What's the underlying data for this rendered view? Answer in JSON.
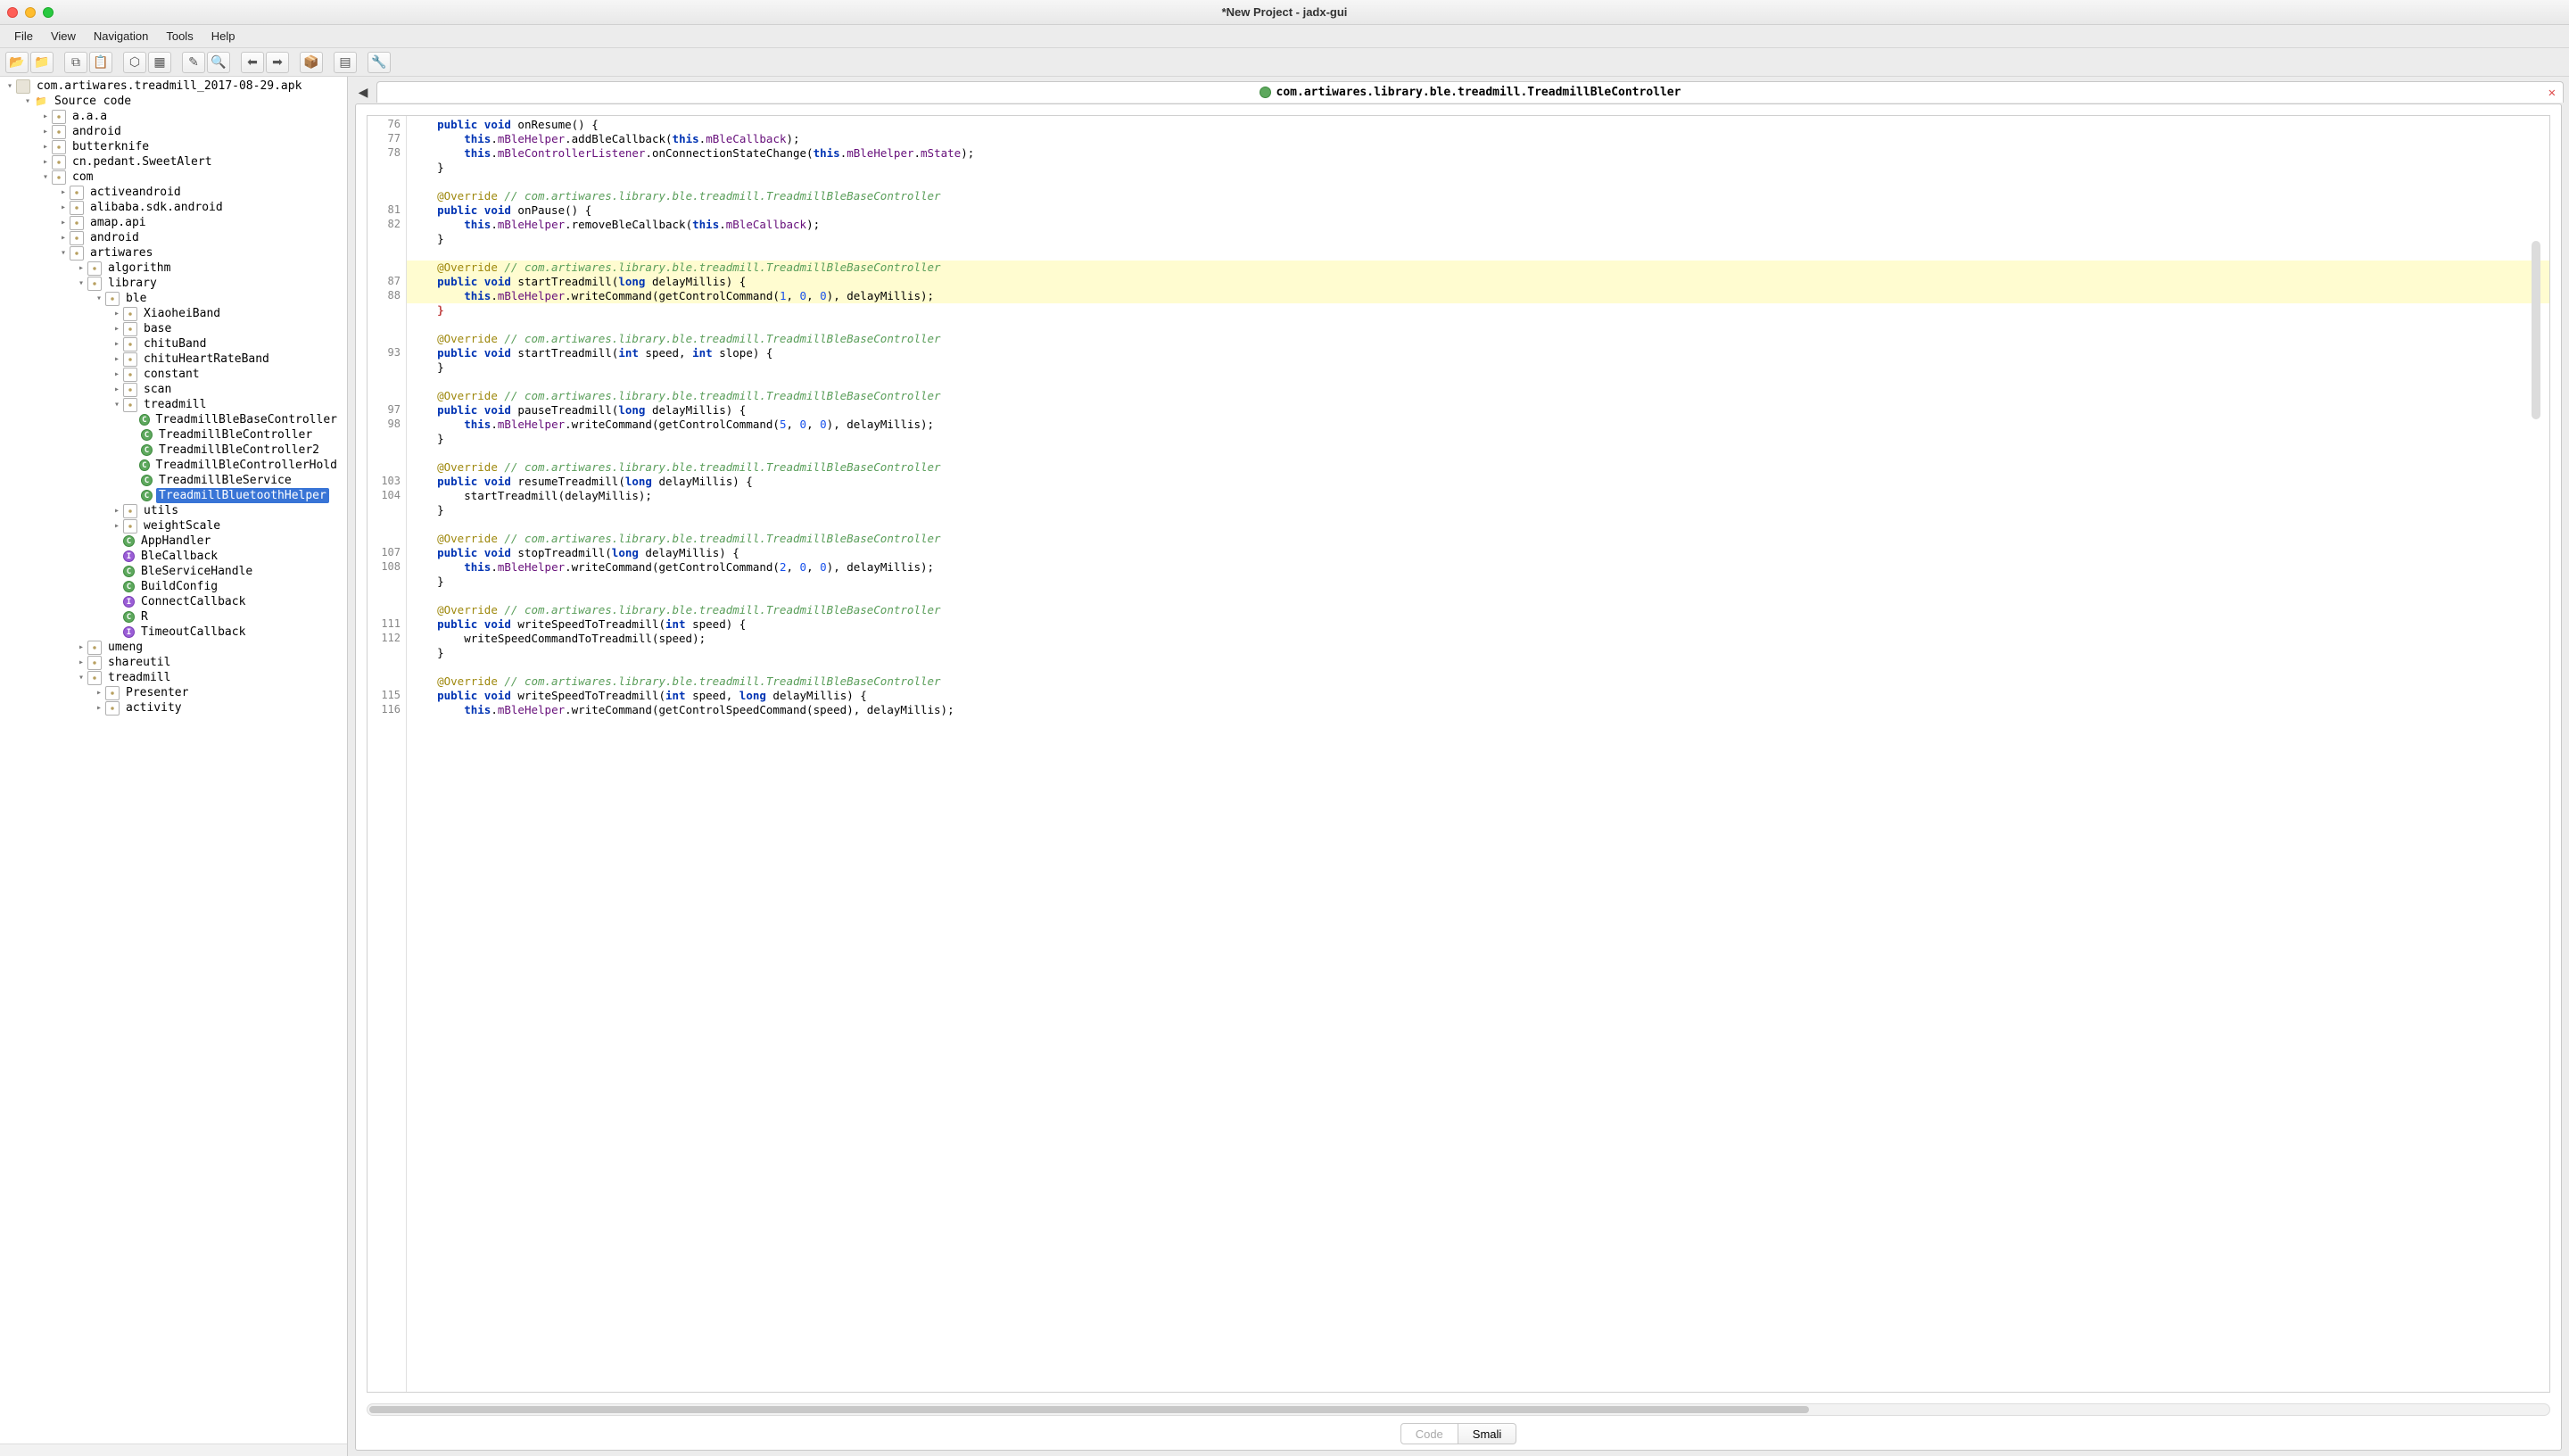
{
  "window": {
    "title": "*New Project - jadx-gui"
  },
  "menubar": [
    "File",
    "View",
    "Navigation",
    "Tools",
    "Help"
  ],
  "toolbar_icons": [
    "folder-open-icon",
    "folder-add-icon",
    "copy-icon",
    "paste-icon",
    "graph-icon",
    "grid-icon",
    "wand-icon",
    "search-icon",
    "back-icon",
    "forward-icon",
    "box-icon",
    "layout-icon",
    "wrench-icon"
  ],
  "tree": [
    {
      "d": 0,
      "t": "v",
      "i": "file",
      "l": "com.artiwares.treadmill_2017-08-29.apk"
    },
    {
      "d": 1,
      "t": "v",
      "i": "folder",
      "l": "Source code"
    },
    {
      "d": 2,
      "t": ">",
      "i": "pkg",
      "l": "a.a.a"
    },
    {
      "d": 2,
      "t": ">",
      "i": "pkg",
      "l": "android"
    },
    {
      "d": 2,
      "t": ">",
      "i": "pkg",
      "l": "butterknife"
    },
    {
      "d": 2,
      "t": ">",
      "i": "pkg",
      "l": "cn.pedant.SweetAlert"
    },
    {
      "d": 2,
      "t": "v",
      "i": "pkg",
      "l": "com"
    },
    {
      "d": 3,
      "t": ">",
      "i": "pkg",
      "l": "activeandroid"
    },
    {
      "d": 3,
      "t": ">",
      "i": "pkg",
      "l": "alibaba.sdk.android"
    },
    {
      "d": 3,
      "t": ">",
      "i": "pkg",
      "l": "amap.api"
    },
    {
      "d": 3,
      "t": ">",
      "i": "pkg",
      "l": "android"
    },
    {
      "d": 3,
      "t": "v",
      "i": "pkg",
      "l": "artiwares"
    },
    {
      "d": 4,
      "t": ">",
      "i": "pkg",
      "l": "algorithm"
    },
    {
      "d": 4,
      "t": "v",
      "i": "pkg",
      "l": "library"
    },
    {
      "d": 5,
      "t": "v",
      "i": "pkg",
      "l": "ble"
    },
    {
      "d": 6,
      "t": ">",
      "i": "pkg",
      "l": "XiaoheiBand"
    },
    {
      "d": 6,
      "t": ">",
      "i": "pkg",
      "l": "base"
    },
    {
      "d": 6,
      "t": ">",
      "i": "pkg",
      "l": "chituBand"
    },
    {
      "d": 6,
      "t": ">",
      "i": "pkg",
      "l": "chituHeartRateBand"
    },
    {
      "d": 6,
      "t": ">",
      "i": "pkg",
      "l": "constant"
    },
    {
      "d": 6,
      "t": ">",
      "i": "pkg",
      "l": "scan"
    },
    {
      "d": 6,
      "t": "v",
      "i": "pkg",
      "l": "treadmill"
    },
    {
      "d": 7,
      "t": " ",
      "i": "cls",
      "l": "TreadmillBleBaseController"
    },
    {
      "d": 7,
      "t": " ",
      "i": "cls",
      "l": "TreadmillBleController"
    },
    {
      "d": 7,
      "t": " ",
      "i": "cls",
      "l": "TreadmillBleController2"
    },
    {
      "d": 7,
      "t": " ",
      "i": "cls",
      "l": "TreadmillBleControllerHold"
    },
    {
      "d": 7,
      "t": " ",
      "i": "cls",
      "l": "TreadmillBleService"
    },
    {
      "d": 7,
      "t": " ",
      "i": "cls",
      "l": "TreadmillBluetoothHelper",
      "sel": true
    },
    {
      "d": 6,
      "t": ">",
      "i": "pkg",
      "l": "utils"
    },
    {
      "d": 6,
      "t": ">",
      "i": "pkg",
      "l": "weightScale"
    },
    {
      "d": 6,
      "t": " ",
      "i": "cls",
      "l": "AppHandler"
    },
    {
      "d": 6,
      "t": " ",
      "i": "iface",
      "l": "BleCallback"
    },
    {
      "d": 6,
      "t": " ",
      "i": "cls",
      "l": "BleServiceHandle"
    },
    {
      "d": 6,
      "t": " ",
      "i": "cls",
      "l": "BuildConfig"
    },
    {
      "d": 6,
      "t": " ",
      "i": "iface",
      "l": "ConnectCallback"
    },
    {
      "d": 6,
      "t": " ",
      "i": "cls",
      "l": "R"
    },
    {
      "d": 6,
      "t": " ",
      "i": "iface",
      "l": "TimeoutCallback"
    },
    {
      "d": 4,
      "t": ">",
      "i": "pkg",
      "l": "umeng"
    },
    {
      "d": 4,
      "t": ">",
      "i": "pkg",
      "l": "shareutil"
    },
    {
      "d": 4,
      "t": "v",
      "i": "pkg",
      "l": "treadmill"
    },
    {
      "d": 5,
      "t": ">",
      "i": "pkg",
      "l": "Presenter"
    },
    {
      "d": 5,
      "t": ">",
      "i": "pkg",
      "l": "activity"
    }
  ],
  "tab": {
    "title": "com.artiwares.library.ble.treadmill.TreadmillBleController"
  },
  "bottom_tabs": {
    "code": "Code",
    "smali": "Smali"
  },
  "code": [
    {
      "n": 76,
      "hl": false,
      "seg": [
        [
          "    ",
          ""
        ],
        [
          "public",
          "kw"
        ],
        [
          " ",
          ""
        ],
        [
          "void",
          "kw"
        ],
        [
          " onResume() {",
          ""
        ]
      ]
    },
    {
      "n": 77,
      "hl": false,
      "seg": [
        [
          "        ",
          ""
        ],
        [
          "this",
          "kw"
        ],
        [
          ".",
          ""
        ],
        [
          "mBleHelper",
          "fld"
        ],
        [
          ".addBleCallback(",
          ""
        ],
        [
          "this",
          "kw"
        ],
        [
          ".",
          ""
        ],
        [
          "mBleCallback",
          "fld"
        ],
        [
          ");",
          ""
        ]
      ]
    },
    {
      "n": 78,
      "hl": false,
      "seg": [
        [
          "        ",
          ""
        ],
        [
          "this",
          "kw"
        ],
        [
          ".",
          ""
        ],
        [
          "mBleControllerListener",
          "fld"
        ],
        [
          ".onConnectionStateChange(",
          ""
        ],
        [
          "this",
          "kw"
        ],
        [
          ".",
          ""
        ],
        [
          "mBleHelper",
          "fld"
        ],
        [
          ".",
          ""
        ],
        [
          "mState",
          "fld"
        ],
        [
          ");",
          ""
        ]
      ]
    },
    {
      "n": "",
      "hl": false,
      "seg": [
        [
          "    }",
          ""
        ]
      ]
    },
    {
      "n": "",
      "hl": false,
      "seg": [
        [
          "",
          ""
        ]
      ]
    },
    {
      "n": "",
      "hl": false,
      "seg": [
        [
          "    ",
          ""
        ],
        [
          "@Override",
          "ann"
        ],
        [
          " ",
          ""
        ],
        [
          "// com.artiwares.library.ble.treadmill.TreadmillBleBaseController",
          "comg"
        ]
      ]
    },
    {
      "n": 81,
      "hl": false,
      "seg": [
        [
          "    ",
          ""
        ],
        [
          "public",
          "kw"
        ],
        [
          " ",
          ""
        ],
        [
          "void",
          "kw"
        ],
        [
          " onPause() {",
          ""
        ]
      ]
    },
    {
      "n": 82,
      "hl": false,
      "seg": [
        [
          "        ",
          ""
        ],
        [
          "this",
          "kw"
        ],
        [
          ".",
          ""
        ],
        [
          "mBleHelper",
          "fld"
        ],
        [
          ".removeBleCallback(",
          ""
        ],
        [
          "this",
          "kw"
        ],
        [
          ".",
          ""
        ],
        [
          "mBleCallback",
          "fld"
        ],
        [
          ");",
          ""
        ]
      ]
    },
    {
      "n": "",
      "hl": false,
      "seg": [
        [
          "    }",
          ""
        ]
      ]
    },
    {
      "n": "",
      "hl": false,
      "seg": [
        [
          "",
          ""
        ]
      ]
    },
    {
      "n": "",
      "hl": true,
      "seg": [
        [
          "    ",
          ""
        ],
        [
          "@Override",
          "ann"
        ],
        [
          " ",
          ""
        ],
        [
          "// com.artiwares.library.ble.treadmill.TreadmillBleBaseController",
          "comg"
        ]
      ]
    },
    {
      "n": 87,
      "hl": true,
      "seg": [
        [
          "    ",
          ""
        ],
        [
          "public",
          "kw"
        ],
        [
          " ",
          ""
        ],
        [
          "void",
          "kw"
        ],
        [
          " startTreadmill(",
          ""
        ],
        [
          "long",
          "kw"
        ],
        [
          " delayMillis) {",
          ""
        ]
      ]
    },
    {
      "n": 88,
      "hl": true,
      "seg": [
        [
          "        ",
          ""
        ],
        [
          "this",
          "kw"
        ],
        [
          ".",
          ""
        ],
        [
          "mBleHelper",
          "fld"
        ],
        [
          ".writeCommand(getControlCommand(",
          ""
        ],
        [
          "1",
          "num"
        ],
        [
          ", ",
          ""
        ],
        [
          "0",
          "num"
        ],
        [
          ", ",
          ""
        ],
        [
          "0",
          "num"
        ],
        [
          "), delayMillis);",
          ""
        ]
      ]
    },
    {
      "n": "",
      "hl": false,
      "seg": [
        [
          "    ",
          ""
        ],
        [
          "}",
          "brk"
        ]
      ]
    },
    {
      "n": "",
      "hl": false,
      "seg": [
        [
          "",
          ""
        ]
      ]
    },
    {
      "n": "",
      "hl": false,
      "seg": [
        [
          "    ",
          ""
        ],
        [
          "@Override",
          "ann"
        ],
        [
          " ",
          ""
        ],
        [
          "// com.artiwares.library.ble.treadmill.TreadmillBleBaseController",
          "comg"
        ]
      ]
    },
    {
      "n": 93,
      "hl": false,
      "seg": [
        [
          "    ",
          ""
        ],
        [
          "public",
          "kw"
        ],
        [
          " ",
          ""
        ],
        [
          "void",
          "kw"
        ],
        [
          " startTreadmill(",
          ""
        ],
        [
          "int",
          "kw"
        ],
        [
          " speed, ",
          ""
        ],
        [
          "int",
          "kw"
        ],
        [
          " slope) {",
          ""
        ]
      ]
    },
    {
      "n": "",
      "hl": false,
      "seg": [
        [
          "    }",
          ""
        ]
      ]
    },
    {
      "n": "",
      "hl": false,
      "seg": [
        [
          "",
          ""
        ]
      ]
    },
    {
      "n": "",
      "hl": false,
      "seg": [
        [
          "    ",
          ""
        ],
        [
          "@Override",
          "ann"
        ],
        [
          " ",
          ""
        ],
        [
          "// com.artiwares.library.ble.treadmill.TreadmillBleBaseController",
          "comg"
        ]
      ]
    },
    {
      "n": 97,
      "hl": false,
      "seg": [
        [
          "    ",
          ""
        ],
        [
          "public",
          "kw"
        ],
        [
          " ",
          ""
        ],
        [
          "void",
          "kw"
        ],
        [
          " pauseTreadmill(",
          ""
        ],
        [
          "long",
          "kw"
        ],
        [
          " delayMillis) {",
          ""
        ]
      ]
    },
    {
      "n": 98,
      "hl": false,
      "seg": [
        [
          "        ",
          ""
        ],
        [
          "this",
          "kw"
        ],
        [
          ".",
          ""
        ],
        [
          "mBleHelper",
          "fld"
        ],
        [
          ".writeCommand(getControlCommand(",
          ""
        ],
        [
          "5",
          "num"
        ],
        [
          ", ",
          ""
        ],
        [
          "0",
          "num"
        ],
        [
          ", ",
          ""
        ],
        [
          "0",
          "num"
        ],
        [
          "), delayMillis);",
          ""
        ]
      ]
    },
    {
      "n": "",
      "hl": false,
      "seg": [
        [
          "    }",
          ""
        ]
      ]
    },
    {
      "n": "",
      "hl": false,
      "seg": [
        [
          "",
          ""
        ]
      ]
    },
    {
      "n": "",
      "hl": false,
      "seg": [
        [
          "    ",
          ""
        ],
        [
          "@Override",
          "ann"
        ],
        [
          " ",
          ""
        ],
        [
          "// com.artiwares.library.ble.treadmill.TreadmillBleBaseController",
          "comg"
        ]
      ]
    },
    {
      "n": 103,
      "hl": false,
      "seg": [
        [
          "    ",
          ""
        ],
        [
          "public",
          "kw"
        ],
        [
          " ",
          ""
        ],
        [
          "void",
          "kw"
        ],
        [
          " resumeTreadmill(",
          ""
        ],
        [
          "long",
          "kw"
        ],
        [
          " delayMillis) {",
          ""
        ]
      ]
    },
    {
      "n": 104,
      "hl": false,
      "seg": [
        [
          "        startTreadmill(delayMillis);",
          ""
        ]
      ]
    },
    {
      "n": "",
      "hl": false,
      "seg": [
        [
          "    }",
          ""
        ]
      ]
    },
    {
      "n": "",
      "hl": false,
      "seg": [
        [
          "",
          ""
        ]
      ]
    },
    {
      "n": "",
      "hl": false,
      "seg": [
        [
          "    ",
          ""
        ],
        [
          "@Override",
          "ann"
        ],
        [
          " ",
          ""
        ],
        [
          "// com.artiwares.library.ble.treadmill.TreadmillBleBaseController",
          "comg"
        ]
      ]
    },
    {
      "n": 107,
      "hl": false,
      "seg": [
        [
          "    ",
          ""
        ],
        [
          "public",
          "kw"
        ],
        [
          " ",
          ""
        ],
        [
          "void",
          "kw"
        ],
        [
          " stopTreadmill(",
          ""
        ],
        [
          "long",
          "kw"
        ],
        [
          " delayMillis) {",
          ""
        ]
      ]
    },
    {
      "n": 108,
      "hl": false,
      "seg": [
        [
          "        ",
          ""
        ],
        [
          "this",
          "kw"
        ],
        [
          ".",
          ""
        ],
        [
          "mBleHelper",
          "fld"
        ],
        [
          ".writeCommand(getControlCommand(",
          ""
        ],
        [
          "2",
          "num"
        ],
        [
          ", ",
          ""
        ],
        [
          "0",
          "num"
        ],
        [
          ", ",
          ""
        ],
        [
          "0",
          "num"
        ],
        [
          "), delayMillis);",
          ""
        ]
      ]
    },
    {
      "n": "",
      "hl": false,
      "seg": [
        [
          "    }",
          ""
        ]
      ]
    },
    {
      "n": "",
      "hl": false,
      "seg": [
        [
          "",
          ""
        ]
      ]
    },
    {
      "n": "",
      "hl": false,
      "seg": [
        [
          "    ",
          ""
        ],
        [
          "@Override",
          "ann"
        ],
        [
          " ",
          ""
        ],
        [
          "// com.artiwares.library.ble.treadmill.TreadmillBleBaseController",
          "comg"
        ]
      ]
    },
    {
      "n": 111,
      "hl": false,
      "seg": [
        [
          "    ",
          ""
        ],
        [
          "public",
          "kw"
        ],
        [
          " ",
          ""
        ],
        [
          "void",
          "kw"
        ],
        [
          " writeSpeedToTreadmill(",
          ""
        ],
        [
          "int",
          "kw"
        ],
        [
          " speed) {",
          ""
        ]
      ]
    },
    {
      "n": 112,
      "hl": false,
      "seg": [
        [
          "        writeSpeedCommandToTreadmill(speed);",
          ""
        ]
      ]
    },
    {
      "n": "",
      "hl": false,
      "seg": [
        [
          "    }",
          ""
        ]
      ]
    },
    {
      "n": "",
      "hl": false,
      "seg": [
        [
          "",
          ""
        ]
      ]
    },
    {
      "n": "",
      "hl": false,
      "seg": [
        [
          "    ",
          ""
        ],
        [
          "@Override",
          "ann"
        ],
        [
          " ",
          ""
        ],
        [
          "// com.artiwares.library.ble.treadmill.TreadmillBleBaseController",
          "comg"
        ]
      ]
    },
    {
      "n": 115,
      "hl": false,
      "seg": [
        [
          "    ",
          ""
        ],
        [
          "public",
          "kw"
        ],
        [
          " ",
          ""
        ],
        [
          "void",
          "kw"
        ],
        [
          " writeSpeedToTreadmill(",
          ""
        ],
        [
          "int",
          "kw"
        ],
        [
          " speed, ",
          ""
        ],
        [
          "long",
          "kw"
        ],
        [
          " delayMillis) {",
          ""
        ]
      ]
    },
    {
      "n": 116,
      "hl": false,
      "seg": [
        [
          "        ",
          ""
        ],
        [
          "this",
          "kw"
        ],
        [
          ".",
          ""
        ],
        [
          "mBleHelper",
          "fld"
        ],
        [
          ".writeCommand(getControlSpeedCommand(speed), delayMillis);",
          ""
        ]
      ]
    }
  ]
}
